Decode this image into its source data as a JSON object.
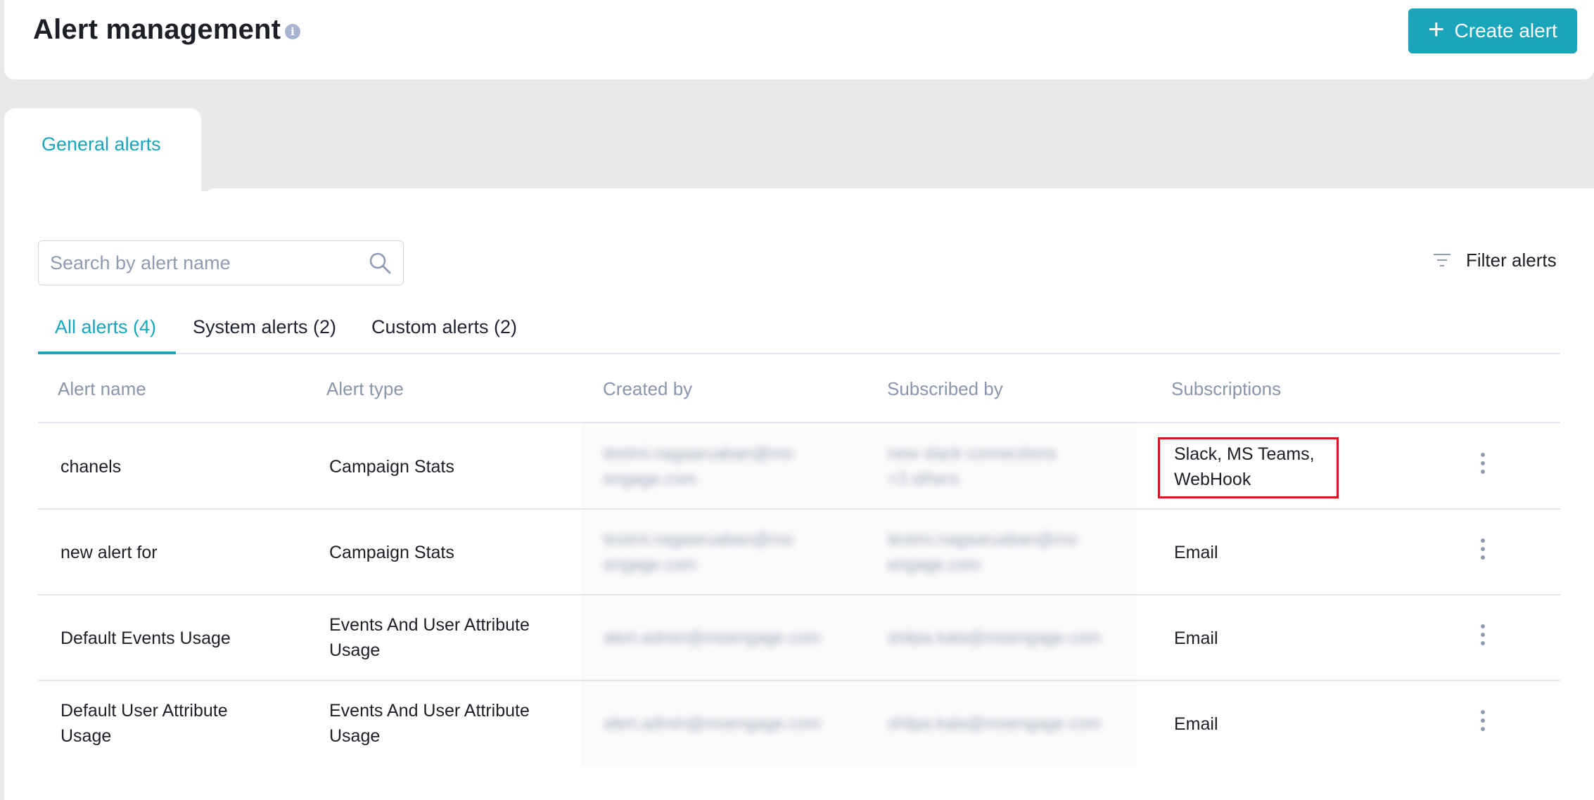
{
  "header": {
    "title": "Alert management",
    "info_icon": "info-icon",
    "create_button_label": "Create alert",
    "create_button_icon": "plus-icon"
  },
  "tabs": [
    {
      "label": "General alerts",
      "active": true
    }
  ],
  "search": {
    "placeholder": "Search by alert name",
    "value": "",
    "icon": "search-icon"
  },
  "filter": {
    "label": "Filter alerts",
    "icon": "filter-icon"
  },
  "subtabs": [
    {
      "label": "All alerts (4)",
      "active": true
    },
    {
      "label": "System alerts (2)",
      "active": false
    },
    {
      "label": "Custom alerts (2)",
      "active": false
    }
  ],
  "table": {
    "columns": [
      "Alert name",
      "Alert type",
      "Created by",
      "Subscribed by",
      "Subscriptions"
    ],
    "rows": [
      {
        "name": [
          "chanels"
        ],
        "type": [
          "Campaign Stats"
        ],
        "created_by": [
          "testmi.nagaaruaban@mo",
          "engage.com"
        ],
        "subscribed_by": [
          "new slack connections",
          "+3 others"
        ],
        "subscriptions": [
          "Slack, MS Teams,",
          "WebHook"
        ]
      },
      {
        "name": [
          "new alert for"
        ],
        "type": [
          "Campaign Stats"
        ],
        "created_by": [
          "testmi.nagaaruaban@mo",
          "engage.com"
        ],
        "subscribed_by": [
          "testmi.nagaaruaban@mo",
          "engage.com"
        ],
        "subscriptions": [
          "Email"
        ]
      },
      {
        "name": [
          "Default Events Usage"
        ],
        "type": [
          "Events And User Attribute",
          "Usage"
        ],
        "created_by": [
          "alert.admin@moengage.com"
        ],
        "subscribed_by": [
          "shilpa.kala@moengage.com"
        ],
        "subscriptions": [
          "Email"
        ]
      },
      {
        "name": [
          "Default User Attribute",
          "Usage"
        ],
        "type": [
          "Events And User Attribute",
          "Usage"
        ],
        "created_by": [
          "alert.admin@moengage.com"
        ],
        "subscribed_by": [
          "shilpa.kala@moengage.com"
        ],
        "subscriptions": [
          "Email"
        ]
      }
    ],
    "row_menu_icon": "kebab-menu-icon"
  },
  "colors": {
    "accent": "#1ba5ba",
    "highlight": "#d9141e",
    "muted_text": "#8a95aa",
    "background": "#e9e9e9"
  }
}
